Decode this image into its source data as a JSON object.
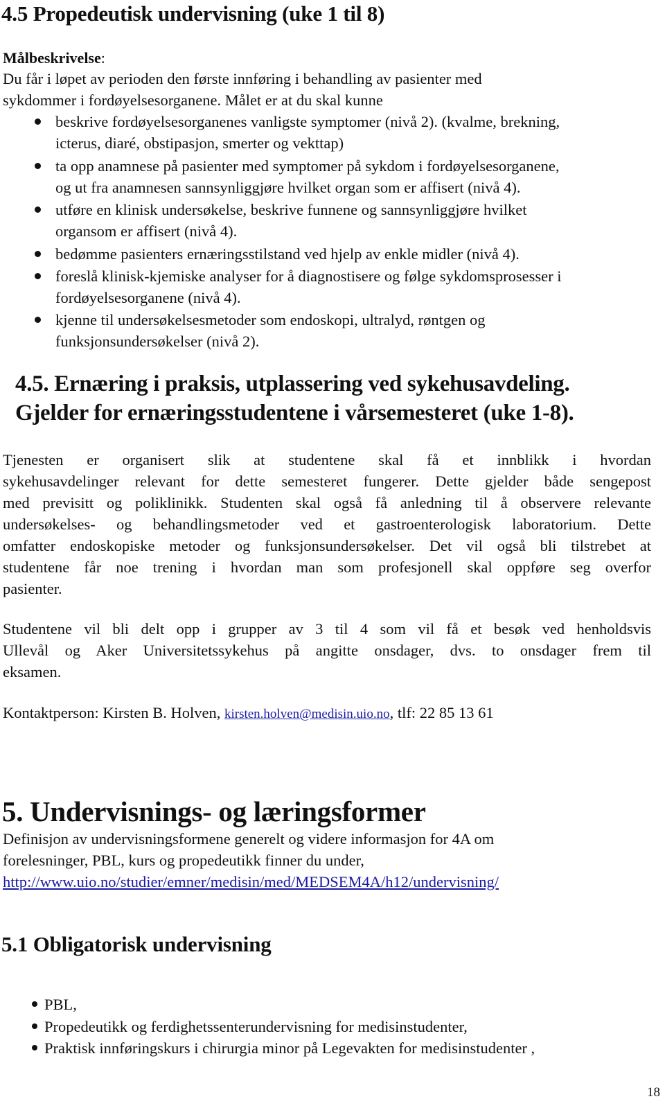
{
  "section_4_5": {
    "heading": "4.5  Propedeutisk undervisning (uke 1 til 8)",
    "goal_label": "Målbeskrivelse",
    "goal_colon": ":",
    "intro_lines": [
      "Du får i løpet av perioden den første innføring i behandling av pasienter med",
      "sykdommer i fordøyelsesorganene. Målet er at du skal kunne"
    ],
    "bullets": [
      {
        "lines": [
          "beskrive fordøyelsesorganenes vanligste symptomer (nivå 2). (kvalme, brekning,",
          "icterus, diaré, obstipasjon, smerter og vekttap)"
        ]
      },
      {
        "lines": [
          "ta opp anamnese på pasienter med symptomer på sykdom i fordøyelsesorganene,",
          " og ut fra anamnesen sannsynliggjøre hvilket organ som er affisert (nivå 4)."
        ]
      },
      {
        "lines": [
          "utføre en klinisk undersøkelse, beskrive funnene og sannsynliggjøre hvilket",
          " organsom er affisert (nivå 4)."
        ]
      },
      {
        "lines": [
          "bedømme pasienters ernæringsstilstand ved hjelp av enkle midler (nivå 4)."
        ]
      },
      {
        "lines": [
          "foreslå klinisk-kjemiske analyser for å diagnostisere og følge sykdomsprosesser i",
          "fordøyelsesorganene (nivå 4)."
        ]
      },
      {
        "lines": [
          "kjenne til undersøkelsesmetoder som endoskopi, ultralyd, røntgen og",
          "funksjonsundersøkelser (nivå 2)."
        ]
      }
    ]
  },
  "section_4_5_nutrition": {
    "heading_line1": "4.5. Ernæring i praksis, utplassering ved sykehusavdeling.",
    "heading_line2": "Gjelder for ernæringsstudentene i vårsemesteret (uke 1-8).",
    "paragraph1_lines": [
      "Tjenesten er organisert slik at studentene skal få et innblikk i hvordan",
      "sykehusavdelinger relevant for dette semesteret fungerer. Dette gjelder både sengepost",
      "med previsitt og poliklinikk. Studenten skal også få anledning til å observere relevante",
      "undersøkelses- og behandlingsmetoder ved et gastroenterologisk laboratorium. Dette",
      "omfatter endoskopiske metoder og funksjonsundersøkelser. Det vil også bli tilstrebet at",
      "studentene får noe trening i hvordan man som profesjonell skal oppføre seg overfor",
      "pasienter."
    ],
    "paragraph2_lines": [
      "Studentene vil bli delt opp i grupper av 3 til 4 som vil få et besøk ved henholdsvis",
      "Ullevål og Aker Universitetssykehus på angitte onsdager, dvs. to onsdager frem til",
      "eksamen."
    ],
    "contact": {
      "prefix": "Kontaktperson: Kirsten B. Holven, ",
      "email": "kirsten.holven@medisin.uio.no",
      "suffix": ", tlf: 22 85 13 61"
    }
  },
  "section_5": {
    "heading": "5. Undervisnings- og læringsformer",
    "text_lines": [
      "Definisjon av undervisningsformene generelt og videre informasjon for  4A om",
      "forelesninger, PBL, kurs og propedeutikk finner du under,"
    ],
    "url": "http://www.uio.no/studier/emner/medisin/med/MEDSEM4A/h12/undervisning/"
  },
  "section_5_1": {
    "heading": "5.1  Obligatorisk undervisning",
    "bullets": [
      "PBL,",
      "Propedeutikk og ferdighetssenterundervisning for medisinstudenter,",
      "Praktisk innføringskurs i chirurgia minor på Legevakten for medisinstudenter ,"
    ]
  },
  "page_number": "18",
  "colors": {
    "text": "#111111",
    "link": "#1a1aa6",
    "background": "#ffffff"
  }
}
